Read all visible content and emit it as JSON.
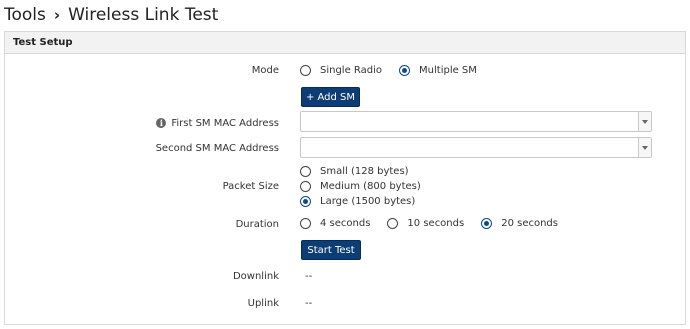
{
  "breadcrumb": {
    "root": "Tools",
    "separator": "›",
    "current": "Wireless Link Test"
  },
  "panel": {
    "title": "Test Setup"
  },
  "mode": {
    "label": "Mode",
    "options": [
      {
        "label": "Single Radio",
        "checked": false
      },
      {
        "label": "Multiple SM",
        "checked": true
      }
    ]
  },
  "add_sm_button": "+ Add SM",
  "first_sm": {
    "label": "First SM MAC Address",
    "value": ""
  },
  "second_sm": {
    "label": "Second SM MAC Address",
    "value": ""
  },
  "packet_size": {
    "label": "Packet Size",
    "options": [
      {
        "label": "Small (128 bytes)",
        "checked": false
      },
      {
        "label": "Medium (800 bytes)",
        "checked": false
      },
      {
        "label": "Large (1500 bytes)",
        "checked": true
      }
    ]
  },
  "duration": {
    "label": "Duration",
    "options": [
      {
        "label": "4 seconds",
        "checked": false
      },
      {
        "label": "10 seconds",
        "checked": false
      },
      {
        "label": "20 seconds",
        "checked": true
      }
    ]
  },
  "start_test_button": "Start Test",
  "downlink": {
    "label": "Downlink",
    "value": "--"
  },
  "uplink": {
    "label": "Uplink",
    "value": "--"
  },
  "colors": {
    "primary_button": "#0d3d75",
    "radio_checked": "#0b4a8b"
  }
}
